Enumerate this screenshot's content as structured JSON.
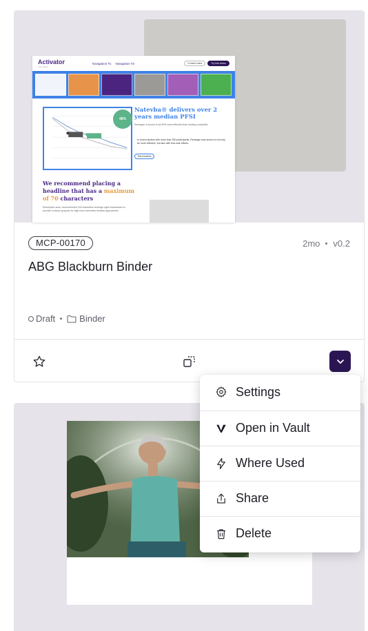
{
  "cards": [
    {
      "id": "MCP-00170",
      "age": "2mo",
      "version": "v0.2",
      "title": "ABG Blackburn Binder",
      "status": "Draft",
      "type": "Binder",
      "preview": {
        "logo": "Activator",
        "logo_sub": "Your brand",
        "nav": [
          "Navigation #1",
          "Navigation #2"
        ],
        "btn_contact": "Contact sales",
        "btn_try": "Try free demo",
        "swatch_colors": [
          "#f1f4fb",
          "#e7944a",
          "#4b2480",
          "#9c9a97",
          "#a35eb8",
          "#4caf50"
        ],
        "headline": "Natevba® delivers over 2 years median PFSI",
        "subtext": "Remegan is shown to be 50% more effective than leading competitor",
        "bullet": "In recent studies with more than 250 participants, Remegan was shown to not only be more effective, but also with less side effects.",
        "pill": "Test headline",
        "badge": "45%",
        "headline2_a": "We recommend placing a headline that has a ",
        "headline2_acc": "maximum of 70",
        "headline2_b": " characters",
        "desc": "Description area, recommended 150 characters leverage agile frameworks to provide a robust synopsis for high level overviews iterative approaches."
      }
    }
  ],
  "menu": {
    "items": [
      {
        "label": "Settings",
        "icon": "gear-icon"
      },
      {
        "label": "Open in Vault",
        "icon": "vault-icon"
      },
      {
        "label": "Where Used",
        "icon": "lightning-icon"
      },
      {
        "label": "Share",
        "icon": "share-icon"
      },
      {
        "label": "Delete",
        "icon": "trash-icon"
      }
    ]
  },
  "colors": {
    "accent": "#2b1654",
    "thumb_bg": "#e6e3ea",
    "preview_blue": "#3f82e6"
  }
}
